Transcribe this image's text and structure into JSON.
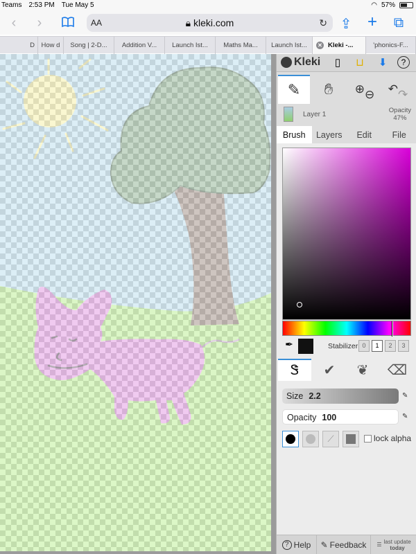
{
  "status_bar": {
    "app": "Teams",
    "time": "2:53 PM",
    "date": "Tue May 5",
    "battery": "57%"
  },
  "safari": {
    "url": "kleki.com",
    "text_size": "AA",
    "tabs": [
      {
        "label": "D"
      },
      {
        "label": "How d"
      },
      {
        "label": "Song | 2-D..."
      },
      {
        "label": "Addition V..."
      },
      {
        "label": "Launch Ist..."
      },
      {
        "label": "Maths Ma..."
      },
      {
        "label": "Launch Ist..."
      },
      {
        "label": "Kleki -...",
        "active": true
      },
      {
        "label": "'phonics-F..."
      }
    ]
  },
  "kleki": {
    "logo": "Kleki",
    "layer": {
      "name": "Layer 1",
      "opacity_label": "Opacity",
      "opacity_value": "47%"
    },
    "tabs": [
      "Brush",
      "Layers",
      "Edit",
      "File"
    ],
    "active_tab": "Brush",
    "stabilizer": {
      "label": "Stabilizer",
      "options": [
        "0",
        "1",
        "2",
        "3"
      ],
      "selected": "1"
    },
    "current_color": "#111111",
    "hue_color": "#d900d9",
    "size": {
      "label": "Size",
      "value": "2.2"
    },
    "opacity": {
      "label": "Opacity",
      "value": "100"
    },
    "lock_alpha": "lock alpha",
    "footer": {
      "help": "Help",
      "feedback": "Feedback",
      "update_line1": "last update",
      "update_line2": "today"
    }
  },
  "drawing": {
    "sky_color": "#b7dced",
    "grass_color": "#b4ee88",
    "sun_color": "#f6ef9f",
    "tree_leaves_color": "#87ae8b",
    "tree_trunk_color": "#99867b",
    "pig_color": "#e08fe1",
    "layer_opacity": 0.47
  }
}
